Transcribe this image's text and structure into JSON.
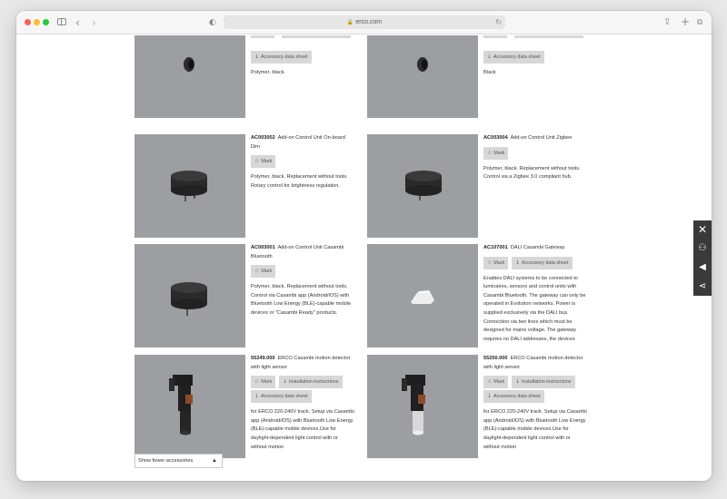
{
  "browser": {
    "url": "erco.com"
  },
  "products": [
    {
      "code": "",
      "name": "",
      "buttons": [
        "Accessory data sheet"
      ],
      "description": "Polymer, black."
    },
    {
      "code": "",
      "name": "",
      "buttons": [
        "Accessory data sheet"
      ],
      "description": "Black"
    },
    {
      "code": "AC003002",
      "name": "Add-on Control Unit On-board Dim",
      "buttons": [
        "Mark"
      ],
      "description": "Polymer, black. Replacement without tools. Rotary control for brightness regulation."
    },
    {
      "code": "AC003004",
      "name": "Add-on Control Unit Zigbee",
      "buttons": [
        "Mark"
      ],
      "description": "Polymer, black. Replacement without tools. Control via a Zigbee 3.0 compliant hub."
    },
    {
      "code": "AC003001",
      "name": "Add-on Control Unit Casambi Bluetooth",
      "buttons": [
        "Mark"
      ],
      "description": "Polymer, black. Replacement without tools. Control via Casambi app (Android/iOS) with Bluetooth Low Energy (BLE)-capable mobile devices or \"Casambi Ready\" products."
    },
    {
      "code": "AC107001",
      "name": "DALI Casambi Gateway",
      "buttons": [
        "Mark",
        "Accessory data sheet"
      ],
      "description": "Enables DALI systems to be connected to luminaires, sensors and control units with Casambi Bluetooth. The gateway can only be operated in Evolution networks. Power is supplied exclusively via the DALI bus. Connection via two lines which must be designed for mains voltage. The gateway requires no DALI addresses, the devices appear as sensors from the perspective of the DALI"
    },
    {
      "code": "55249.000",
      "name": "ERCO Casambi motion detector with light sensor",
      "buttons": [
        "Mark",
        "Installation instructions",
        "Accessory data sheet"
      ],
      "description": "for ERCO 220-240V track. Setup via Casambi app (Android/iOS) with Bluetooth Low Energy (BLE)-capable mobile devices.Use for daylight-dependent light control with or without motion"
    },
    {
      "code": "55250.000",
      "name": "ERCO Casambi motion detector with light sensor",
      "buttons": [
        "Mark",
        "Installation instructions",
        "Accessory data sheet"
      ],
      "description": "for ERCO 220-240V track. Setup via Casambi app (Android/iOS) with Bluetooth Low Energy (BLE)-capable mobile devices.Use for daylight-dependent light control with or without motion"
    }
  ],
  "show_fewer": "Show fewer accessories",
  "colors": {
    "image_bg": "#9c9ea2",
    "button_bg": "#d7d7d7",
    "floating_bar": "#3a3a3a"
  },
  "icons": {
    "download": "download-arrow-icon",
    "mark": "star-icon",
    "close": "close-icon",
    "contact": "person-icon",
    "audio": "speaker-icon",
    "share": "share-icon"
  }
}
